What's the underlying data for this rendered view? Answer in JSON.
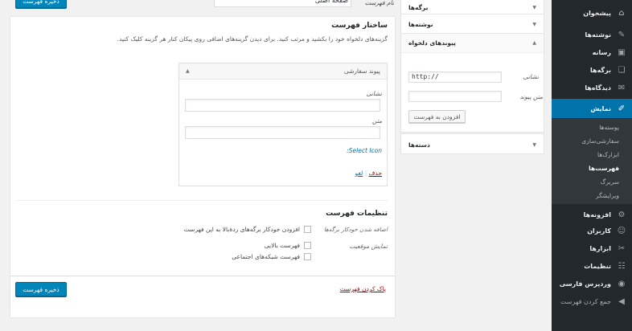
{
  "top": {
    "save_label": "ذخیره فهرست",
    "menu_name_label": "نام فهرست",
    "menu_name_value": "صفحه اصلی"
  },
  "sidebar": {
    "items": [
      {
        "label": "پیشخوان",
        "icon": "dashboard-icon",
        "glyph": "⌂"
      },
      {
        "label": "نوشته‌ها",
        "icon": "pin-icon",
        "glyph": "✎"
      },
      {
        "label": "رسانه",
        "icon": "media-icon",
        "glyph": "▣"
      },
      {
        "label": "برگه‌ها",
        "icon": "pages-icon",
        "glyph": "❏"
      },
      {
        "label": "دیدگاه‌ها",
        "icon": "comments-icon",
        "glyph": "✉"
      },
      {
        "label": "نمایش",
        "icon": "appearance-icon",
        "glyph": "✐"
      },
      {
        "label": "افزونه‌ها",
        "icon": "plugins-icon",
        "glyph": "⚙"
      },
      {
        "label": "کاربران",
        "icon": "users-icon",
        "glyph": "☺"
      },
      {
        "label": "ابزارها",
        "icon": "tools-icon",
        "glyph": "✂"
      },
      {
        "label": "تنظیمات",
        "icon": "settings-icon",
        "glyph": "☷"
      },
      {
        "label": "وردپرس فارسی",
        "icon": "wp-persian-icon",
        "glyph": "◉"
      },
      {
        "label": "جمع کردن فهرست",
        "icon": "collapse-icon",
        "glyph": "◀"
      }
    ],
    "submenu": [
      "پوسته‌ها",
      "سفارشی‌سازی",
      "ابزارک‌ها",
      "فهرست‌ها",
      "سربرگ",
      "ویرایشگر"
    ]
  },
  "boxes": {
    "pages": "برگه‌ها",
    "posts": "نوشته‌ها",
    "custom_links": "پیوندهای دلخواه",
    "url_label": "نشانی",
    "url_value": "http://",
    "link_text_label": "متن پیوند",
    "link_text_value": "",
    "add_to_menu": "افزودن به فهرست",
    "categories": "دسته‌ها"
  },
  "structure": {
    "title": "ساختار فهرست",
    "desc": "گزینه‌های دلخواه خود را بکشید و مرتب کنید. برای دیدن گزینه‌های اضافی روی پیکان کنار هر گزینه کلیک کنید.",
    "item_title": "پیوند سفارشی",
    "url_label": "نشانی",
    "url_value": "",
    "text_label": "متن",
    "text_value": "",
    "icon_link": "Select Icon",
    "icon_link_suffix": ":",
    "remove": "حذف",
    "sep": "|",
    "cancel": "لغو"
  },
  "settings": {
    "title": "تنظیمات فهرست",
    "auto_add_label": "اضافه شدن خودکار برگه‌ها",
    "auto_add_option": "افزودن خودکار برگه‌های ردهٔ‌بالا به این فهرست",
    "location_label": "نمایش موقعیت",
    "locations": [
      "فهرست بالایی",
      "فهرست شبکه‌های اجتماعی"
    ]
  },
  "footer": {
    "save_label": "ذخیره فهرست",
    "delete_label": "پاک کردن فهرست"
  }
}
